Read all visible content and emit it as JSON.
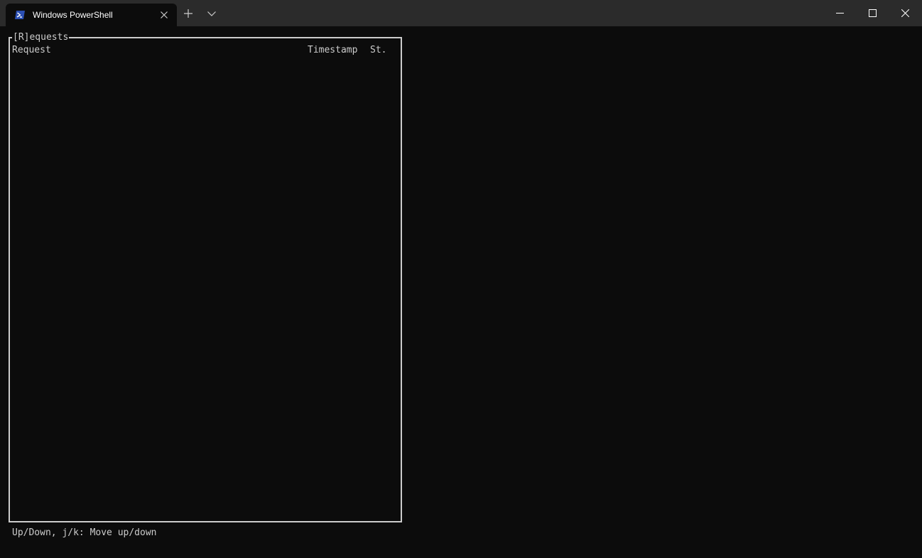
{
  "window": {
    "tab_title": "Windows PowerShell",
    "icons": {
      "tab": "powershell-icon",
      "tab_close": "close-icon",
      "new_tab": "plus-icon",
      "dropdown": "chevron-down-icon",
      "minimize": "minimize-icon",
      "maximize": "maximize-icon",
      "close": "close-icon"
    },
    "colors": {
      "titlebar": "#2b2b2b",
      "background": "#0c0c0c",
      "text": "#cccccc",
      "powershell_icon": "#2b4fb3"
    }
  },
  "panel": {
    "title": "[R]equests",
    "columns": {
      "request": "Request",
      "timestamp": "Timestamp",
      "status": "St."
    },
    "rows": []
  },
  "status_bar": {
    "help_text": "Up/Down, j/k: Move up/down"
  }
}
